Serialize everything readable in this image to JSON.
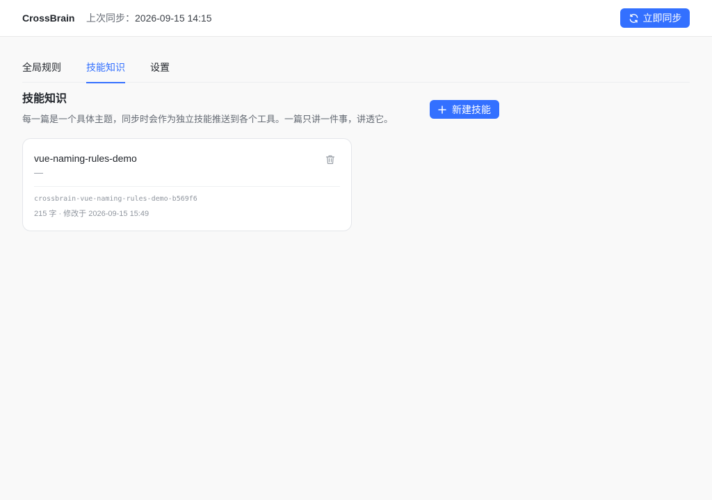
{
  "header": {
    "brand": "CrossBrain",
    "sync_label": "上次同步：",
    "sync_time": "2026-09-15 14:15",
    "sync_button_label": "立即同步"
  },
  "tabs": [
    {
      "label": "全局规则",
      "active": false
    },
    {
      "label": "技能知识",
      "active": true
    },
    {
      "label": "设置",
      "active": false
    }
  ],
  "section": {
    "title": "技能知识",
    "description": "每一篇是一个具体主题，同步时会作为独立技能推送到各个工具。一篇只讲一件事，讲透它。",
    "new_button_label": "新建技能"
  },
  "skills": [
    {
      "name": "vue-naming-rules-demo",
      "description": "—",
      "id": "crossbrain-vue-naming-rules-demo-b569f6",
      "meta": "215 字 · 修改于 2026-09-15 15:49"
    }
  ],
  "icons": {
    "sync": "refresh-icon",
    "new": "plus-icon",
    "delete": "trash-icon"
  },
  "colors": {
    "accent": "#3370ff",
    "background": "#f9f9f9",
    "card": "#ffffff",
    "text_primary": "#1f2329",
    "text_secondary": "#646a73",
    "text_muted": "#8f959e"
  }
}
